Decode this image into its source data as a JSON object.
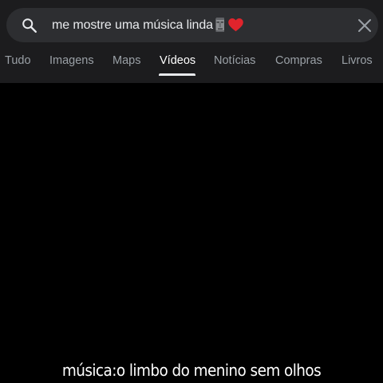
{
  "search": {
    "query": "me mostre uma música linda",
    "query_emojis": [
      "moai-emoji",
      "red-heart-emoji"
    ],
    "search_icon": "search-icon",
    "clear_icon": "close-icon"
  },
  "tabs": [
    {
      "label": "Tudo",
      "active": false
    },
    {
      "label": "Imagens",
      "active": false
    },
    {
      "label": "Maps",
      "active": false
    },
    {
      "label": "Vídeos",
      "active": true
    },
    {
      "label": "Notícias",
      "active": false
    },
    {
      "label": "Compras",
      "active": false
    },
    {
      "label": "Livros",
      "active": false
    }
  ],
  "video": {
    "caption": "música:o limbo do menino sem olhos"
  },
  "colors": {
    "topbar": "#1c1c1e",
    "search_pill": "#2d2e31",
    "text_primary": "#e8eaed",
    "tab_inactive": "#9aa0a6",
    "tab_active": "#ffffff",
    "heart": "#e0242c",
    "video_bg": "#000000"
  }
}
